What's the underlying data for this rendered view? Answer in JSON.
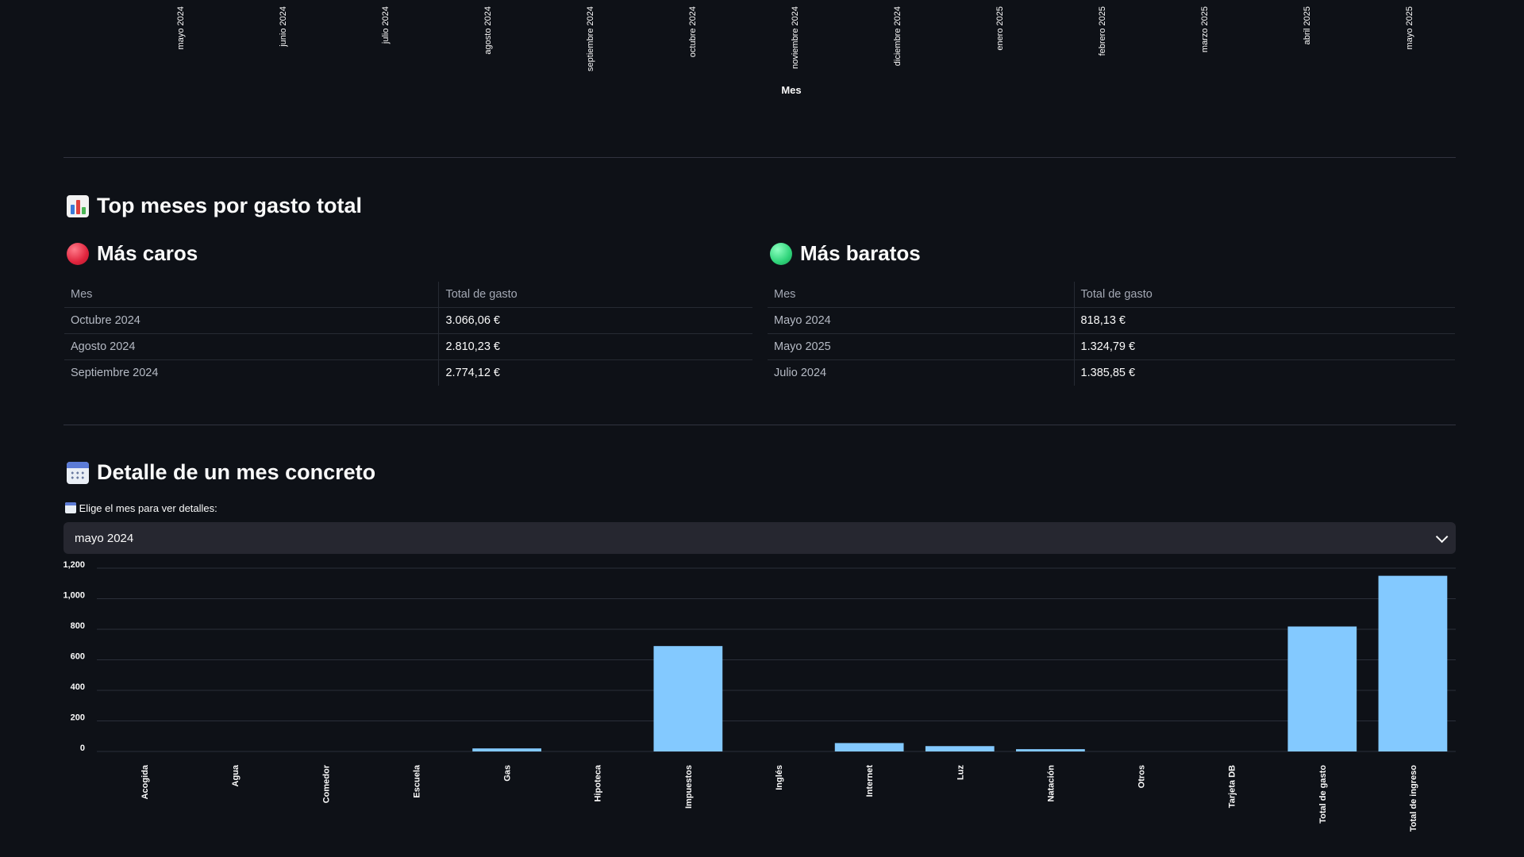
{
  "previous_chart_axis": {
    "ticks": [
      "mayo 2024",
      "junio 2024",
      "julio 2024",
      "agosto 2024",
      "septiembre 2024",
      "octubre 2024",
      "noviembre 2024",
      "diciembre 2024",
      "enero 2025",
      "febrero 2025",
      "marzo 2025",
      "abril 2025",
      "mayo 2025"
    ],
    "title": "Mes"
  },
  "top_section": {
    "title": "Top meses por gasto total",
    "icon": "bar-chart-icon"
  },
  "expensive": {
    "title": "Más caros",
    "icon": "red-circle-icon",
    "headers": [
      "Mes",
      "Total de gasto"
    ],
    "rows": [
      {
        "mes": "Octubre 2024",
        "total": "3.066,06 €"
      },
      {
        "mes": "Agosto 2024",
        "total": "2.810,23 €"
      },
      {
        "mes": "Septiembre 2024",
        "total": "2.774,12 €"
      }
    ]
  },
  "cheap": {
    "title": "Más baratos",
    "icon": "green-circle-icon",
    "headers": [
      "Mes",
      "Total de gasto"
    ],
    "rows": [
      {
        "mes": "Mayo 2024",
        "total": "818,13 €"
      },
      {
        "mes": "Mayo 2025",
        "total": "1.324,79 €"
      },
      {
        "mes": "Julio 2024",
        "total": "1.385,85 €"
      }
    ]
  },
  "detail_section": {
    "title": "Detalle de un mes concreto",
    "icon": "calendar-icon",
    "select_label": "Elige el mes para ver detalles:",
    "selected_value": "mayo 2024"
  },
  "colors": {
    "background": "#0e1117",
    "bar": "#83c9ff",
    "divider": "#31333f"
  },
  "chart_data": {
    "type": "bar",
    "categories": [
      "Acogida",
      "Agua",
      "Comedor",
      "Escuela",
      "Gas",
      "Hipoteca",
      "Impuestos",
      "Inglés",
      "Internet",
      "Luz",
      "Natación",
      "Otros",
      "Tarjeta DB",
      "Total de gasto",
      "Total de ingreso"
    ],
    "values": [
      0,
      0,
      0,
      0,
      20,
      0,
      690,
      0,
      55,
      35,
      15,
      0,
      0,
      818.13,
      1150
    ],
    "yticks": [
      "0",
      "200",
      "400",
      "600",
      "800",
      "1,000",
      "1,200"
    ],
    "ylim": [
      0,
      1200
    ],
    "grid": true
  }
}
